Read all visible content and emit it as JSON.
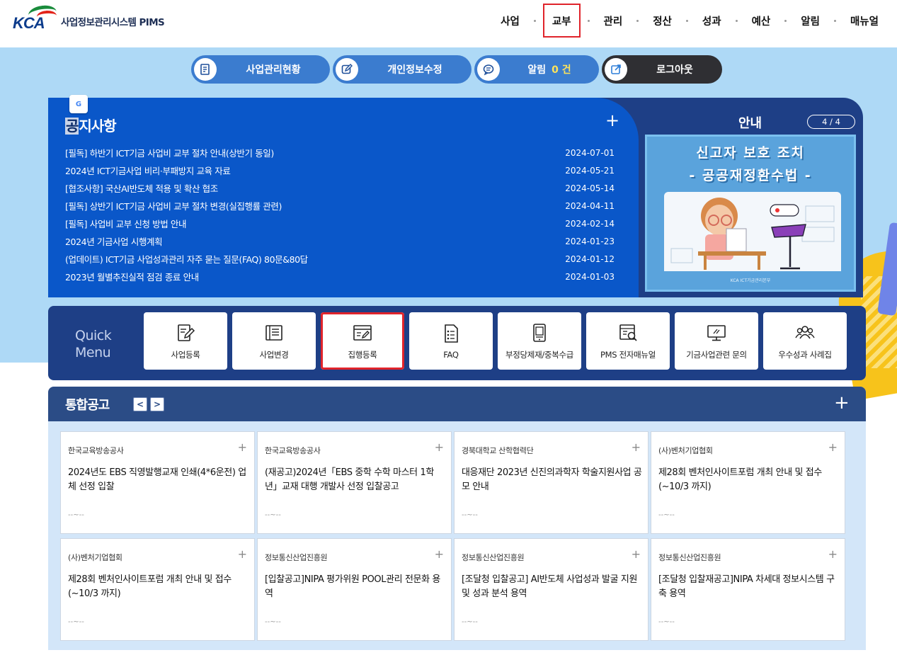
{
  "header": {
    "logo_brand": "KCA",
    "logo_text": "사업정보관리시스템 PIMS",
    "nav": [
      "사업",
      "교부",
      "관리",
      "정산",
      "성과",
      "예산",
      "알림",
      "매뉴얼"
    ],
    "active_nav": "교부"
  },
  "topbar": {
    "status": "사업관리현황",
    "profile": "개인정보수정",
    "alert": "알림",
    "alert_count": "0 건",
    "logout": "로그아웃"
  },
  "notice": {
    "title_first": "공",
    "title_rest": "지사항",
    "more": "+",
    "translate_badge": "G",
    "items": [
      {
        "title": "[필독] 하반기 ICT기금 사업비 교부 절차 안내(상반기 동일)",
        "date": "2024-07-01"
      },
      {
        "title": "2024년 ICT기금사업 비리·부패방지 교육 자료",
        "date": "2024-05-21"
      },
      {
        "title": "[협조사항] 국산AI반도체 적용 및 확산 협조",
        "date": "2024-05-14"
      },
      {
        "title": "[필독] 상반기 ICT기금 사업비 교부 절차 변경(실집행률 관련)",
        "date": "2024-04-11"
      },
      {
        "title": "[필독] 사업비 교부 신청 방법 안내",
        "date": "2024-02-14"
      },
      {
        "title": "2024년 기금사업 시행계획",
        "date": "2024-01-23"
      },
      {
        "title": "(업데이트) ICT기금 사업성과관리 자주 묻는 질문(FAQ) 80문&80답",
        "date": "2024-01-12"
      },
      {
        "title": "2023년 월별추진실적 점검 종료 안내",
        "date": "2024-01-03"
      }
    ]
  },
  "guide": {
    "title": "안내",
    "page": "4 / 4",
    "card_line1": "신고자 보호 조치",
    "card_line2": "- 공공재정환수법 -",
    "card_footer": "KCA ICT기금관리본부"
  },
  "quick_menu": {
    "label_line1": "Quick",
    "label_line2": "Menu",
    "items": [
      {
        "label": "사업등록",
        "icon": "edit-document-icon"
      },
      {
        "label": "사업변경",
        "icon": "list-document-icon"
      },
      {
        "label": "집행등록",
        "icon": "browser-edit-icon"
      },
      {
        "label": "FAQ",
        "icon": "checklist-icon"
      },
      {
        "label": "부정당제재/중복수급",
        "icon": "tablet-icon"
      },
      {
        "label": "PMS 전자매뉴얼",
        "icon": "search-document-icon"
      },
      {
        "label": "기금사업관련 문의",
        "icon": "monitor-icon"
      },
      {
        "label": "우수성과 사례집",
        "icon": "people-icon"
      }
    ],
    "active_index": 2
  },
  "board": {
    "title": "통합공고",
    "prev": "<",
    "next": ">",
    "more": "+",
    "cards": [
      {
        "org": "한국교육방송공사",
        "title": "2024년도 EBS 직영발행교재 인쇄(4*6운전) 업체 선정 입찰",
        "date": "--~--"
      },
      {
        "org": "한국교육방송공사",
        "title": "(재공고)2024년「EBS 중학 수학 마스터 1학년」교재 대행 개발사 선정 입찰공고",
        "date": "--~--"
      },
      {
        "org": "경북대학교 산학협력단",
        "title": "대응재단 2023년 신진의과학자 학술지원사업 공모 안내",
        "date": "--~--"
      },
      {
        "org": "(사)벤처기업협회",
        "title": "제28회 벤처인사이트포럼 개최 안내 및 접수(~10/3 까지)",
        "date": "--~--"
      },
      {
        "org": "(사)벤처기업협회",
        "title": "제28회 벤처인사이트포럼 개최 안내 및 접수(~10/3 까지)",
        "date": "--~--"
      },
      {
        "org": "정보통신산업진흥원",
        "title": "[입찰공고]NIPA 평가위원 POOL관리 전문화 용역",
        "date": "--~--"
      },
      {
        "org": "정보통신산업진흥원",
        "title": "[조달청 입찰공고] AI반도체 사업성과 발굴 지원 및 성과 분석 용역",
        "date": "--~--"
      },
      {
        "org": "정보통신산업진흥원",
        "title": "[조달청 입찰재공고]NIPA 차세대 정보시스템 구축 용역",
        "date": "--~--"
      }
    ]
  }
}
